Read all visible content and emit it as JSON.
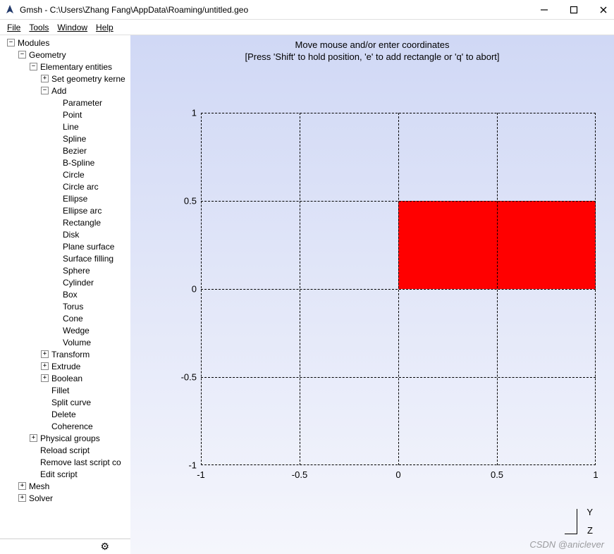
{
  "window": {
    "title": "Gmsh - C:\\Users\\Zhang Fang\\AppData\\Roaming/untitled.geo"
  },
  "menubar": [
    "File",
    "Tools",
    "Window",
    "Help"
  ],
  "tree": {
    "root": "Modules",
    "geometry": "Geometry",
    "elementary": "Elementary entities",
    "set_kernel": "Set geometry kerne",
    "add": "Add",
    "add_items": [
      "Parameter",
      "Point",
      "Line",
      "Spline",
      "Bezier",
      "B-Spline",
      "Circle",
      "Circle arc",
      "Ellipse",
      "Ellipse arc",
      "Rectangle",
      "Disk",
      "Plane surface",
      "Surface filling",
      "Sphere",
      "Cylinder",
      "Box",
      "Torus",
      "Cone",
      "Wedge",
      "Volume"
    ],
    "transform": "Transform",
    "extrude": "Extrude",
    "boolean": "Boolean",
    "fillet": "Fillet",
    "split_curve": "Split curve",
    "delete": "Delete",
    "coherence": "Coherence",
    "physical": "Physical groups",
    "reload": "Reload script",
    "remove_last": "Remove last script co",
    "edit_script": "Edit script",
    "mesh": "Mesh",
    "solver": "Solver"
  },
  "viewport": {
    "line1": "Move mouse and/or enter coordinates",
    "line2": "[Press 'Shift' to hold position, 'e' to add rectangle or 'q' to abort]"
  },
  "chart_data": {
    "type": "area",
    "title": "",
    "xlabel": "",
    "ylabel": "",
    "xlim": [
      -1,
      1
    ],
    "ylim": [
      -1,
      1
    ],
    "x_ticks": [
      -1,
      -0.5,
      0,
      0.5,
      1
    ],
    "y_ticks": [
      -1,
      -0.5,
      0,
      0.5,
      1
    ],
    "shapes": [
      {
        "type": "rectangle",
        "x0": 0,
        "y0": 0,
        "x1": 1,
        "y1": 0.5,
        "fill": "#ff0000"
      }
    ],
    "axes_compass": {
      "up": "Y",
      "depth": "Z"
    }
  },
  "watermark": "CSDN @aniclever",
  "icons": {
    "gear": "⚙"
  }
}
